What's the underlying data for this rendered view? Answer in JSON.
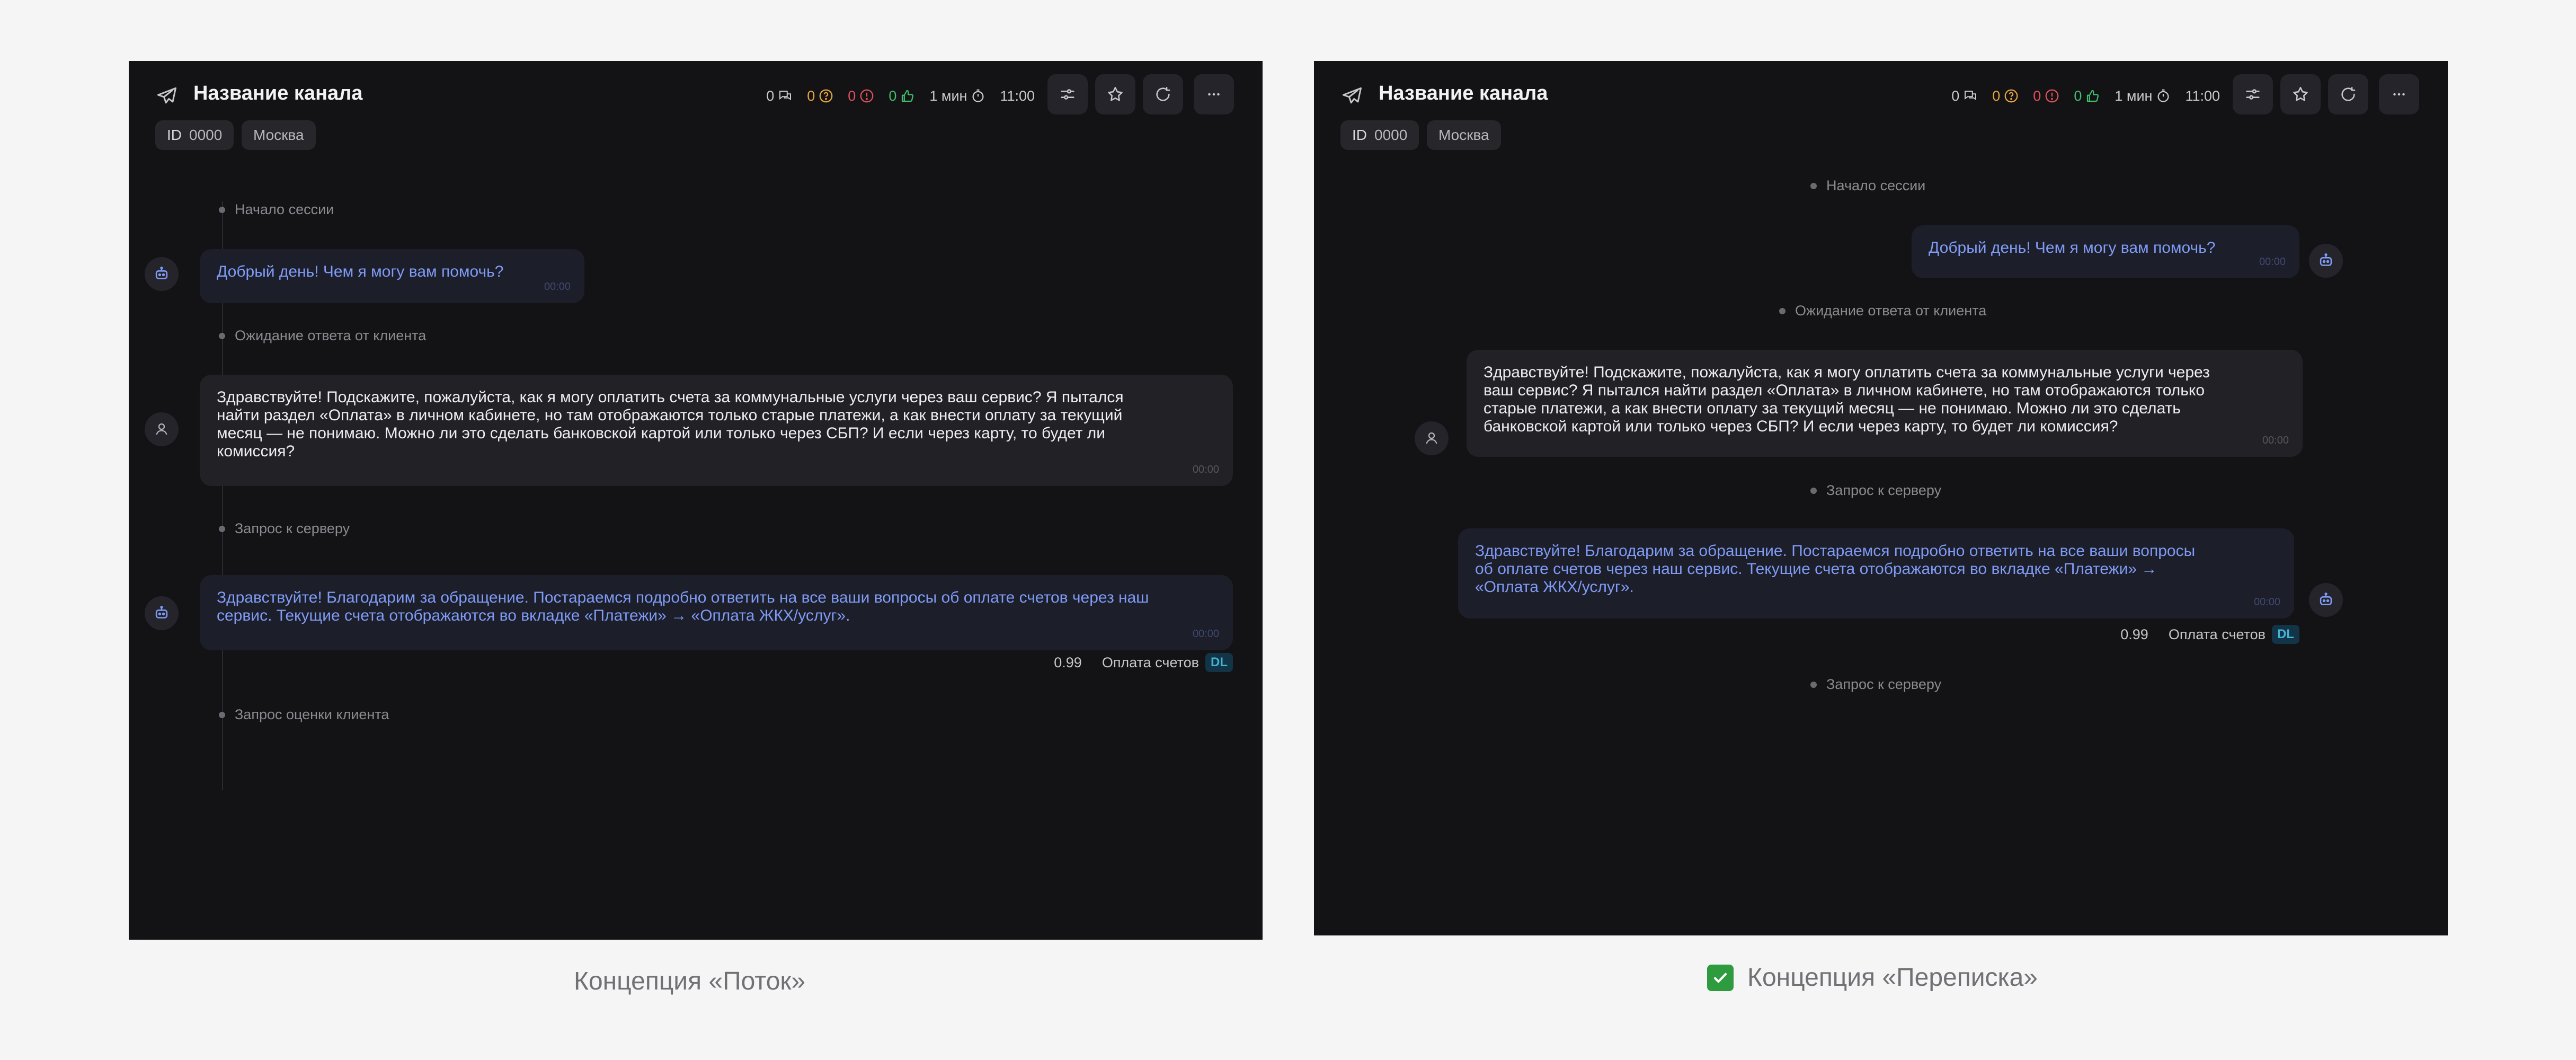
{
  "left": {
    "channel_title": "Название канала",
    "id_label": "ID",
    "id_value": "0000",
    "city": "Москва",
    "stats": {
      "messages": "0",
      "questions": "0",
      "alerts": "0",
      "likes": "0",
      "duration": "1 мин",
      "time": "11:00"
    },
    "events": {
      "session_start": "Начало сессии",
      "waiting": "Ожидание ответа от клиента",
      "server_request": "Запрос к серверу",
      "rating_request": "Запрос оценки клиента"
    },
    "messages": {
      "bot_greeting": "Добрый день! Чем я могу вам помочь?",
      "bot_greeting_time": "00:00",
      "user_question": "Здравствуйте! Подскажите, пожалуйста, как я могу оплатить счета за коммунальные услуги через ваш сервис? Я пытался найти раздел «Оплата» в личном кабинете, но там отображаются только старые платежи, а как внести оплату за текущий месяц — не понимаю. Можно ли это сделать банковской картой или только через СБП? И если через карту, то будет ли комиссия?",
      "user_question_time": "00:00",
      "bot_answer": "Здравствуйте! Благодарим за обращение. Постараемся подробно ответить на все ваши вопросы об оплате счетов через наш сервис. Текущие счета отображаются во вкладке «Платежи» → «Оплата ЖКХ/услуг».",
      "bot_answer_time": "00:00"
    },
    "meta": {
      "score": "0.99",
      "intent": "Оплата счетов",
      "badge": "DL"
    },
    "caption": "Концепция «Поток»"
  },
  "right": {
    "channel_title": "Название канала",
    "id_label": "ID",
    "id_value": "0000",
    "city": "Москва",
    "stats": {
      "messages": "0",
      "questions": "0",
      "alerts": "0",
      "likes": "0",
      "duration": "1 мин",
      "time": "11:00"
    },
    "events": {
      "session_start": "Начало сессии",
      "waiting": "Ожидание ответа от клиента",
      "server_request": "Запрос к серверу",
      "server_request_2": "Запрос к серверу"
    },
    "messages": {
      "bot_greeting": "Добрый день! Чем я могу вам помочь?",
      "bot_greeting_time": "00:00",
      "user_question": "Здравствуйте! Подскажите, пожалуйста, как я могу оплатить счета за коммунальные услуги через ваш сервис? Я пытался найти раздел «Оплата» в личном кабинете, но там отображаются только старые платежи, а как внести оплату за текущий месяц — не понимаю. Можно ли это сделать банковской картой или только через СБП? И если через карту, то будет ли комиссия?",
      "user_question_time": "00:00",
      "bot_answer": "Здравствуйте! Благодарим за обращение. Постараемся подробно ответить на все ваши вопросы об оплате счетов через наш сервис. Текущие счета отображаются во вкладке «Платежи» → «Оплата ЖКХ/услуг».",
      "bot_answer_time": "00:00"
    },
    "meta": {
      "score": "0.99",
      "intent": "Оплата счетов",
      "badge": "DL"
    },
    "caption": "Концепция «Переписка»"
  },
  "colors": {
    "panel_bg": "#131316",
    "bot_text": "#7f9bf5",
    "accent_green": "#2e9b3e",
    "badge_text": "#43b3d6"
  }
}
